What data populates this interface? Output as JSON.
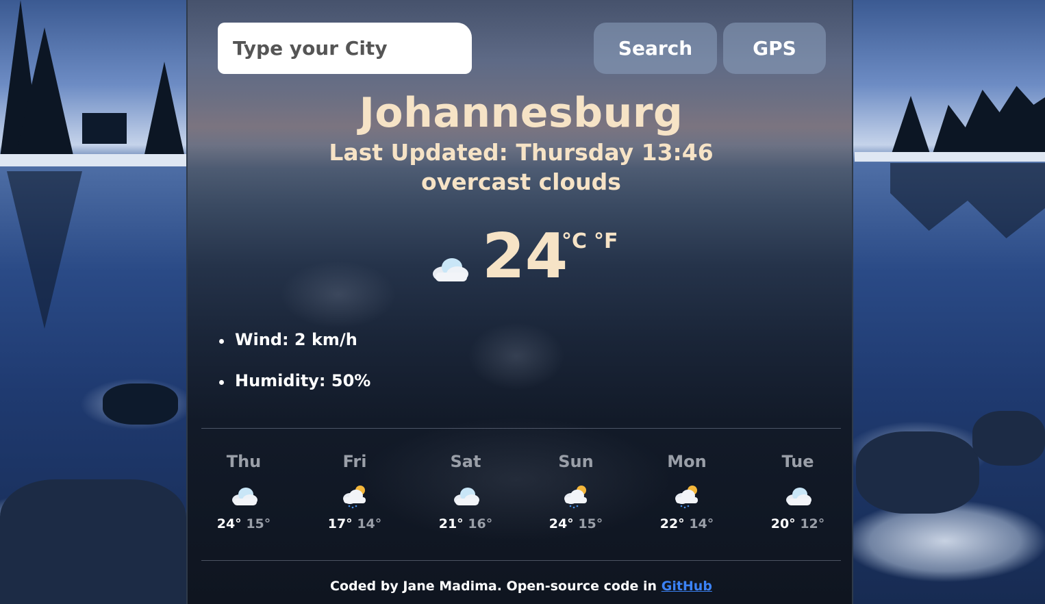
{
  "search": {
    "placeholder": "Type your City",
    "search_label": "Search",
    "gps_label": "GPS"
  },
  "current": {
    "city": "Johannesburg",
    "last_updated": "Last Updated: Thursday 13:46",
    "description": "overcast clouds",
    "icon": "cloud-icon",
    "temperature": "24",
    "unit_celsius": "°C",
    "unit_fahrenheit": "°F",
    "wind": "Wind: 2 km/h",
    "humidity": "Humidity: 50%"
  },
  "forecast": [
    {
      "day": "Thu",
      "icon": "cloud-icon",
      "max": "24°",
      "min": "15°"
    },
    {
      "day": "Fri",
      "icon": "sun-cloud-rain-icon",
      "max": "17°",
      "min": "14°"
    },
    {
      "day": "Sat",
      "icon": "cloud-icon",
      "max": "21°",
      "min": "16°"
    },
    {
      "day": "Sun",
      "icon": "sun-cloud-rain-icon",
      "max": "24°",
      "min": "15°"
    },
    {
      "day": "Mon",
      "icon": "sun-cloud-rain-icon",
      "max": "22°",
      "min": "14°"
    },
    {
      "day": "Tue",
      "icon": "cloud-icon",
      "max": "20°",
      "min": "12°"
    }
  ],
  "footer": {
    "text": "Coded by Jane Madima. Open-source code in",
    "link_label": "GitHub"
  },
  "colors": {
    "heading": "#f6e3c6",
    "link": "#3b82f6",
    "muted": "#9a9fa8"
  }
}
